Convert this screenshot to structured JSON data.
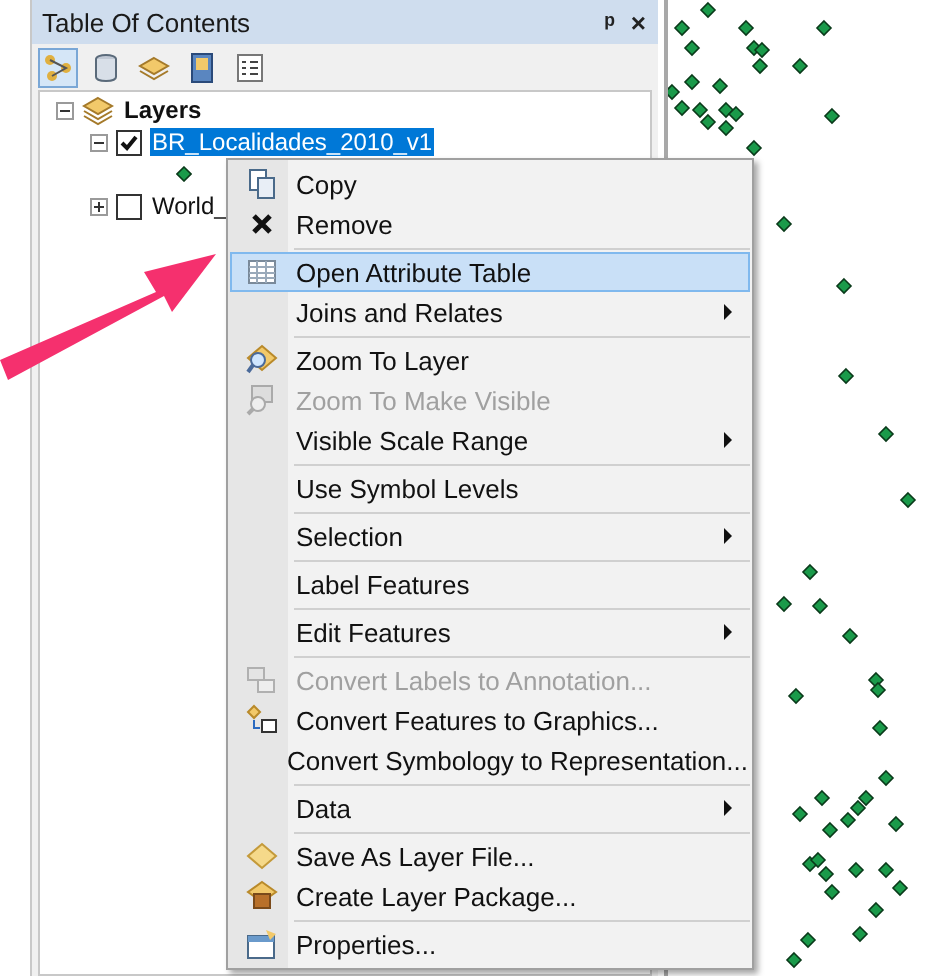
{
  "panel": {
    "title": "Table Of Contents",
    "pin": "ᵖ",
    "close": "×"
  },
  "toolbar": [
    {
      "selected": true
    },
    {
      "selected": false
    },
    {
      "selected": false
    },
    {
      "selected": false
    },
    {
      "selected": false
    }
  ],
  "tree": {
    "label": "Layers",
    "expanded": true,
    "children": [
      {
        "label": "BR_Localidades_2010_v1",
        "checked": true,
        "selected": true,
        "expanded": true
      },
      {
        "label": "World_",
        "checked": false,
        "selected": false,
        "expanded": false
      }
    ]
  },
  "menu": [
    {
      "label": "Copy",
      "divider_before": false,
      "disabled": false,
      "submenu": false,
      "selected": false
    },
    {
      "label": "Remove",
      "divider_before": false,
      "disabled": false,
      "submenu": false,
      "selected": false
    },
    {
      "label": "Open Attribute Table",
      "divider_before": true,
      "disabled": false,
      "submenu": false,
      "selected": true
    },
    {
      "label": "Joins and Relates",
      "divider_before": false,
      "disabled": false,
      "submenu": true,
      "selected": false
    },
    {
      "label": "Zoom To Layer",
      "divider_before": true,
      "disabled": false,
      "submenu": false,
      "selected": false
    },
    {
      "label": "Zoom To Make Visible",
      "divider_before": false,
      "disabled": true,
      "submenu": false,
      "selected": false
    },
    {
      "label": "Visible Scale Range",
      "divider_before": false,
      "disabled": false,
      "submenu": true,
      "selected": false
    },
    {
      "label": "Use Symbol Levels",
      "divider_before": true,
      "disabled": false,
      "submenu": false,
      "selected": false
    },
    {
      "label": "Selection",
      "divider_before": true,
      "disabled": false,
      "submenu": true,
      "selected": false
    },
    {
      "label": "Label Features",
      "divider_before": true,
      "disabled": false,
      "submenu": false,
      "selected": false
    },
    {
      "label": "Edit Features",
      "divider_before": true,
      "disabled": false,
      "submenu": true,
      "selected": false
    },
    {
      "label": "Convert Labels to Annotation...",
      "divider_before": true,
      "disabled": true,
      "submenu": false,
      "selected": false
    },
    {
      "label": "Convert Features to Graphics...",
      "divider_before": false,
      "disabled": false,
      "submenu": false,
      "selected": false
    },
    {
      "label": "Convert Symbology to Representation...",
      "divider_before": false,
      "disabled": false,
      "submenu": false,
      "selected": false
    },
    {
      "label": "Data",
      "divider_before": true,
      "disabled": false,
      "submenu": true,
      "selected": false
    },
    {
      "label": "Save As Layer File...",
      "divider_before": true,
      "disabled": false,
      "submenu": false,
      "selected": false
    },
    {
      "label": "Create Layer Package...",
      "divider_before": false,
      "disabled": false,
      "submenu": false,
      "selected": false
    },
    {
      "label": "Properties...",
      "divider_before": true,
      "disabled": false,
      "submenu": false,
      "selected": false
    }
  ]
}
